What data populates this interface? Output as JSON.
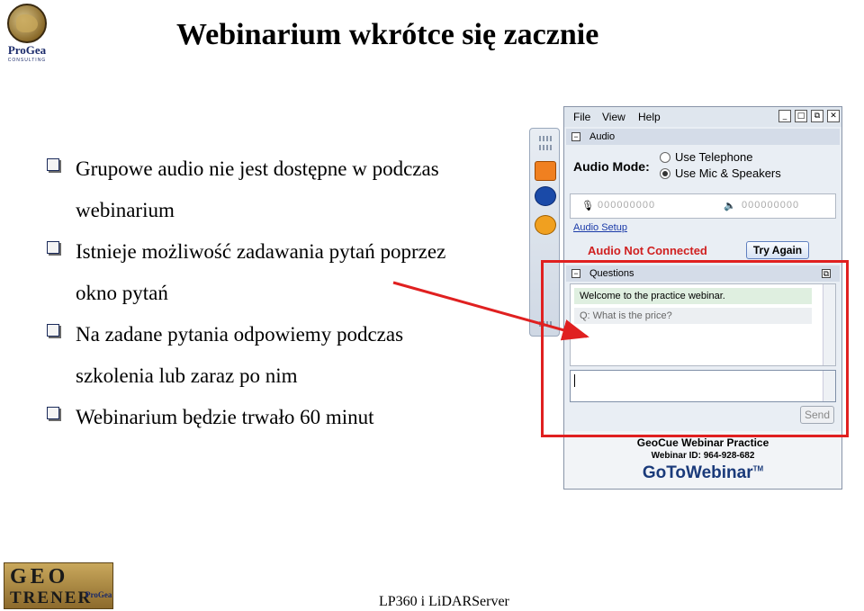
{
  "title": "Webinarium wkrótce się zacznie",
  "logo_top": {
    "name": "ProGea",
    "sub": "CONSULTING"
  },
  "bullets": [
    {
      "line1": "Grupowe audio nie jest dostępne w podczas",
      "line2": "webinarium"
    },
    {
      "line1": "Istnieje możliwość zadawania pytań poprzez",
      "line2": "okno pytań"
    },
    {
      "line1": "Na zadane pytania odpowiemy podczas",
      "line2": "szkolenia lub zaraz po nim"
    },
    {
      "line1": "Webinarium będzie trwało 60 minut"
    }
  ],
  "gtw": {
    "menu": [
      "File",
      "View",
      "Help"
    ],
    "audio_section": "Audio",
    "audio_mode_label": "Audio Mode:",
    "option_telephone": "Use Telephone",
    "option_mic": "Use Mic & Speakers",
    "mic_level": "000000000",
    "speaker_level": "000000000",
    "audio_setup": "Audio Setup",
    "audio_status": "Audio Not Connected",
    "try_again": "Try Again",
    "questions_section": "Questions",
    "messages": [
      "Welcome to the practice webinar.",
      "Q: What is the price?"
    ],
    "send": "Send",
    "webinar_name": "GeoCue Webinar Practice",
    "webinar_id": "Webinar ID: 964-928-682",
    "brand": "GoToWebinar",
    "tm": "TM"
  },
  "logo_bottom": {
    "geo": "GEO",
    "trener": "TRENER",
    "pg": "ProGea"
  },
  "footer": "LP360 i LiDARServer",
  "colors": {
    "highlight": "#e02020",
    "link": "#1a3aa8"
  }
}
